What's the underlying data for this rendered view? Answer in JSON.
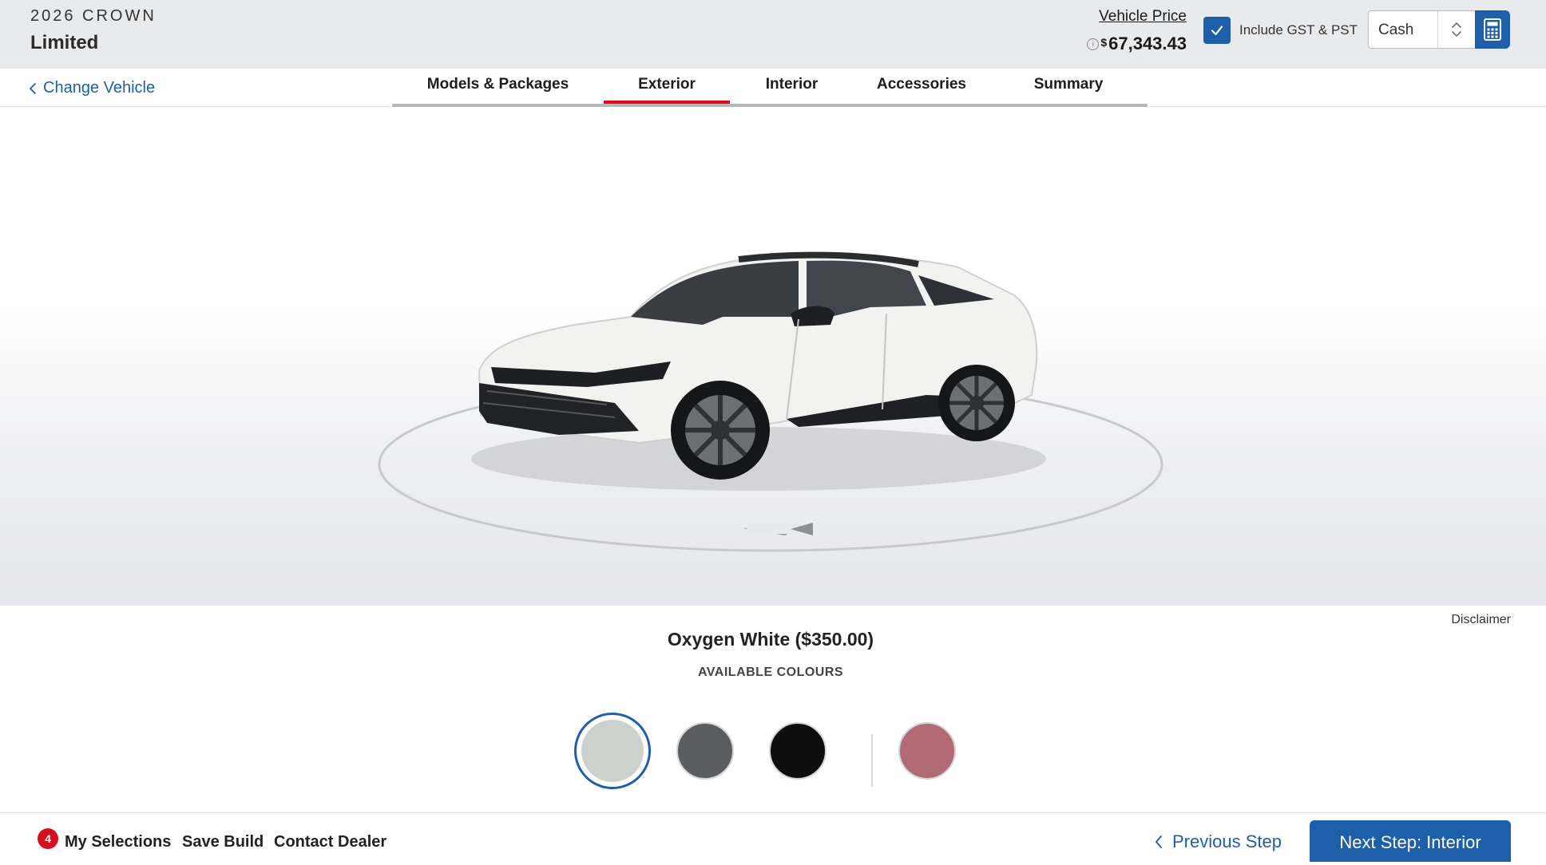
{
  "header": {
    "year_model": "2026 CROWN",
    "trim": "Limited",
    "price_label": "Vehicle Price",
    "price_currency": "$",
    "price_value": "67,343.43",
    "tax_checkbox_checked": true,
    "tax_label": "Include GST & PST",
    "payment_type": "Cash",
    "accent_color": "#1d5fa8"
  },
  "nav": {
    "change_vehicle": "Change Vehicle",
    "tabs": [
      {
        "label": "Models & Packages",
        "active": false
      },
      {
        "label": "Exterior",
        "active": true
      },
      {
        "label": "Interior",
        "active": false
      },
      {
        "label": "Accessories",
        "active": false
      },
      {
        "label": "Summary",
        "active": false
      }
    ],
    "active_tab_color": "#e10a1d"
  },
  "colour_picker": {
    "disclaimer": "Disclaimer",
    "selected_colour": "Oxygen White ($350.00)",
    "available_label": "AVAILABLE COLOURS",
    "swatches": [
      {
        "color": "#cdd1ce",
        "selected": true
      },
      {
        "color": "#5a5c5e",
        "selected": false
      },
      {
        "color": "#0e0e0e",
        "selected": false
      },
      {
        "color": "#b26a74",
        "selected": false
      }
    ]
  },
  "footer": {
    "selections_count": "4",
    "my_selections": "My Selections",
    "save_build": "Save Build",
    "contact_dealer": "Contact Dealer",
    "previous_step": "Previous Step",
    "next_step": "Next Step: Interior"
  }
}
